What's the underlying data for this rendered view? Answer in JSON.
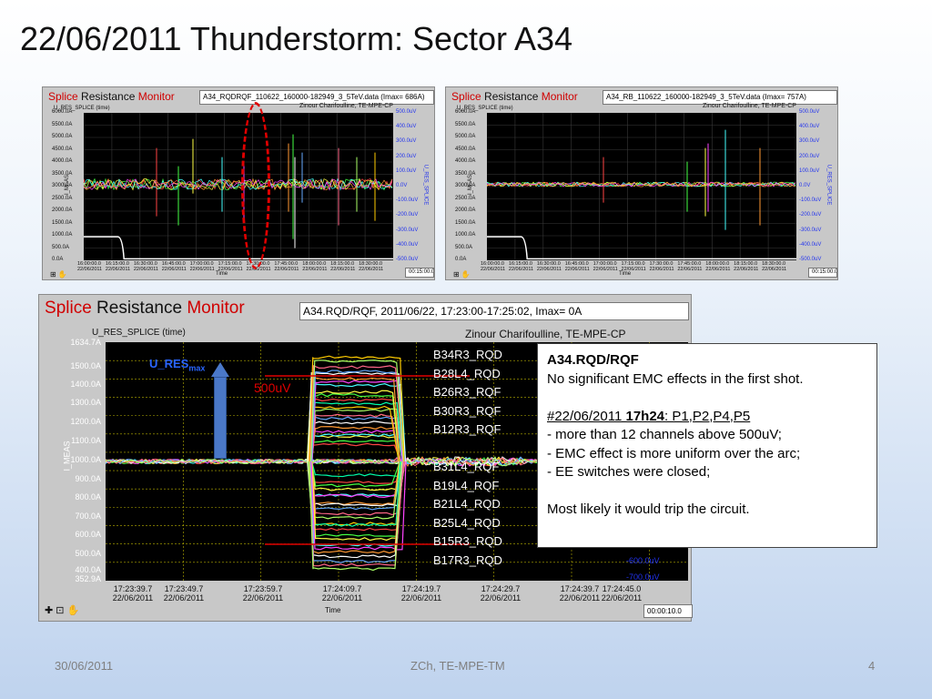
{
  "slide": {
    "title": "22/06/2011 Thunderstorm: Sector A34",
    "footer_date": "30/06/2011",
    "footer_center": "ZCh, TE-MPE-TM",
    "page_number": "4"
  },
  "monitor": {
    "brand_s": "S",
    "brand_plice": "plice ",
    "brand_resistance": "Resistance ",
    "brand_m": "M",
    "brand_onitor": "onitor",
    "accent": "#d00000"
  },
  "panel_left": {
    "file": "A34_RQDRQF_110622_160000-182949_3_5TeV.data (Imax= 686A)",
    "chart_label": "U_RES_SPLICE (time)",
    "author": "Zinour Charifoulline, TE-MPE-CP",
    "y_left_ticks": [
      "6000.0A",
      "5500.0A",
      "5000.0A",
      "4500.0A",
      "4000.0A",
      "3500.0A",
      "3000.0A",
      "2500.0A",
      "2000.0A",
      "1500.0A",
      "1000.0A",
      "500.0A",
      "0.0A"
    ],
    "y_right_ticks": [
      "500.0uV",
      "400.0uV",
      "300.0uV",
      "200.0uV",
      "100.0uV",
      "0.0V",
      "-100.0uV",
      "-200.0uV",
      "-300.0uV",
      "-400.0uV",
      "-500.0uV"
    ],
    "x_ticks": [
      "16:00:00.0",
      "16:15:00.0",
      "16:30:00.0",
      "16:45:00.0",
      "17:00:00.0",
      "17:15:00.0",
      "17:30:00.0",
      "17:45:00.0",
      "18:00:00.0",
      "18:15:00.0",
      "18:30:00.0"
    ],
    "x_date": "22/06/2011",
    "x_label": "Time",
    "y_left_label": "I_MEAS",
    "y_right_label": "U_RES_SPLICE",
    "duration": "00:15:00.0"
  },
  "panel_right": {
    "file": "A34_RB_110622_160000-182949_3_5TeV.data (Imax= 757A)",
    "chart_label": "U_RES_SPLICE (time)",
    "author": "Zinour Charifoulline, TE-MPE-CP",
    "y_left_ticks": [
      "6000.0A",
      "5500.0A",
      "5000.0A",
      "4500.0A",
      "4000.0A",
      "3500.0A",
      "3000.0A",
      "2500.0A",
      "2000.0A",
      "1500.0A",
      "1000.0A",
      "500.0A",
      "0.0A"
    ],
    "y_right_ticks": [
      "500.0uV",
      "400.0uV",
      "300.0uV",
      "200.0uV",
      "100.0uV",
      "0.0V",
      "-100.0uV",
      "-200.0uV",
      "-300.0uV",
      "-400.0uV",
      "-500.0uV"
    ],
    "x_ticks": [
      "16:00:00.0",
      "16:15:00.0",
      "16:30:00.0",
      "16:45:00.0",
      "17:00:00.0",
      "17:15:00.0",
      "17:30:00.0",
      "17:45:00.0",
      "18:00:00.0",
      "18:15:00.0",
      "18:30:00.0"
    ],
    "x_date": "22/06/2011",
    "x_label": "Time",
    "y_left_label": "I_MEAS",
    "y_right_label": "U_RES_SPLICE",
    "duration": "00:15:00.0"
  },
  "panel_big": {
    "file": "A34.RQD/RQF, 2011/06/22, 17:23:00-17:25:02, Imax= 0A",
    "chart_label": "U_RES_SPLICE (time)",
    "author": "Zinour Charifoulline, TE-MPE-CP",
    "y_left_ticks": [
      "1634.7A",
      "1500.0A",
      "1400.0A",
      "1300.0A",
      "1200.0A",
      "1100.0A",
      "1000.0A",
      "900.0A",
      "800.0A",
      "700.0A",
      "600.0A",
      "500.0A",
      "400.0A",
      "352.9A"
    ],
    "y_right_ticks": [
      "-600.0uV",
      "-700.0uV"
    ],
    "x_ticks": [
      {
        "t": "17:23:39.7",
        "d": "22/06/2011"
      },
      {
        "t": "17:23:49.7",
        "d": "22/06/2011"
      },
      {
        "t": "17:23:59.7",
        "d": "22/06/2011"
      },
      {
        "t": "17:24:09.7",
        "d": "22/06/2011"
      },
      {
        "t": "17:24:19.7",
        "d": "22/06/2011"
      },
      {
        "t": "17:24:29.7",
        "d": "22/06/2011"
      },
      {
        "t": "17:24:39.7",
        "d": "22/06/2011"
      },
      {
        "t": "17:24:45.0",
        "d": "22/06/2011"
      }
    ],
    "x_label": "Time",
    "y_left_label": "I_MEAS",
    "duration": "00:00:10.0",
    "annot_ures": "U_RES",
    "annot_ures_sub": "max",
    "annot_500": "500uV",
    "channels_top": [
      "B34R3_RQD",
      "B28L4_RQD",
      "B26R3_RQF",
      "B30R3_RQF",
      "B12R3_RQF"
    ],
    "channels_bottom": [
      "B31L4_RQF",
      "B19L4_RQF",
      "B21L4_RQD",
      "B25L4_RQD",
      "B15R3_RQD",
      "B17R3_RQD"
    ]
  },
  "callout": {
    "heading": "A34.RQD/RQF",
    "line1": "No significant EMC effects in the first shot.",
    "shot_date": "#22/06/2011 ",
    "shot_time": "17h24",
    "shot_rest": ": P1,P2,P4,P5",
    "bullet1": "- more than 12 channels above 500uV;",
    "bullet2": "- EMC effect is more uniform over the arc;",
    "bullet3": "- EE switches were closed;",
    "conclusion": "Most likely it would trip the circuit."
  }
}
